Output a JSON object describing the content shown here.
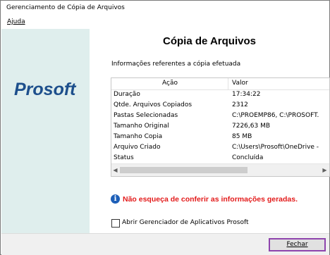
{
  "window": {
    "title": "Gerenciamento de Cópia de Arquivos"
  },
  "menu": {
    "help": "Ajuda"
  },
  "sidebar": {
    "logo_text": "Prosoft"
  },
  "main": {
    "heading": "Cópia de Arquivos",
    "info_label": "Informações referentes a cópia efetuada",
    "table": {
      "columns": [
        "Ação",
        "Valor"
      ],
      "rows": [
        {
          "action": "Duração",
          "value": "17:34:22"
        },
        {
          "action": "Qtde. Arquivos Copiados",
          "value": "2312"
        },
        {
          "action": "Pastas Selecionadas",
          "value": "C:\\PROEMP86, C:\\PROSOFT."
        },
        {
          "action": "Tamanho Original",
          "value": "7226,63 MB"
        },
        {
          "action": "Tamanho Copia",
          "value": "85 MB"
        },
        {
          "action": "Arquivo Criado",
          "value": "C:\\Users\\Prosoft\\OneDrive -"
        },
        {
          "action": "Status",
          "value": "Concluída"
        }
      ]
    },
    "notice": "Não esqueça de conferir as informações geradas.",
    "checkbox_label": "Abrir Gerenciador de Aplicativos Prosoft"
  },
  "footer": {
    "close_label": "Fechar"
  },
  "icons": {
    "info": "info-icon",
    "scroll_left": "scroll-left-arrow-icon",
    "scroll_right": "scroll-right-arrow-icon"
  },
  "colors": {
    "sidebar_bg": "#dfeeed",
    "logo": "#1d4f8c",
    "notice_text": "#e31b1b",
    "info_icon": "#1d5fb8",
    "focus_border": "#8e44ad"
  }
}
